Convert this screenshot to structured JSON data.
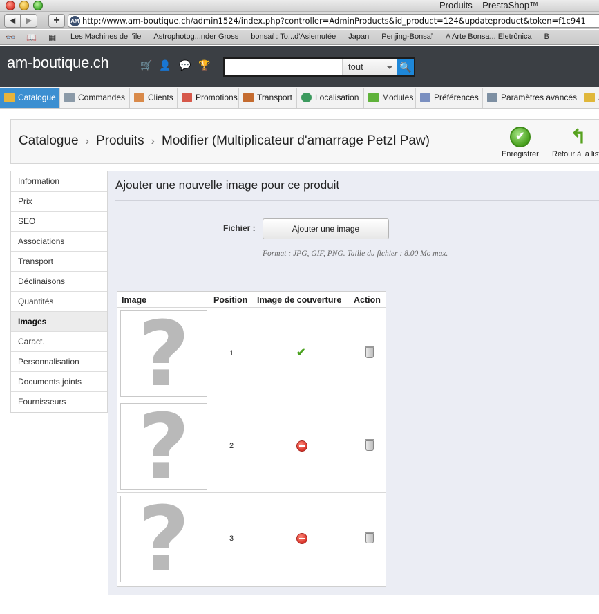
{
  "window": {
    "title": "Produits – PrestaShop™"
  },
  "browser": {
    "back": "◀",
    "forward": "▶",
    "add": "+",
    "favicon": "AM",
    "url": "http://www.am-boutique.ch/admin1524/index.php?controller=AdminProducts&id_product=124&updateproduct&token=f1c941",
    "bookmarks": [
      "Les Machines de l'île",
      "Astrophotog...nder Gross",
      "bonsaï : To...d'Asiemutée",
      "Japan",
      "Penjing-Bonsaï",
      "A Arte Bonsa... Eletrônica",
      "B"
    ]
  },
  "header": {
    "brand": "am-boutique.ch",
    "search_placeholder": "",
    "search_scope": "tout"
  },
  "tabs": [
    {
      "label": "Catalogue",
      "color": "#e9b43a"
    },
    {
      "label": "Commandes",
      "color": "#8b9aa8"
    },
    {
      "label": "Clients",
      "color": "#d98a4a"
    },
    {
      "label": "Promotions",
      "color": "#d6584a"
    },
    {
      "label": "Transport",
      "color": "#c46b2f"
    },
    {
      "label": "Localisation",
      "color": "#3c9a5e"
    },
    {
      "label": "Modules",
      "color": "#5fb23a"
    },
    {
      "label": "Préférences",
      "color": "#7a8fc0"
    },
    {
      "label": "Paramètres avancés",
      "color": "#7d8fa2"
    },
    {
      "label": "A",
      "color": "#e0b73a"
    }
  ],
  "toolbar": {
    "breadcrumb": [
      "Catalogue",
      "Produits",
      "Modifier (Multiplicateur d'amarrage Petzl Paw)"
    ],
    "save_label": "Enregistrer",
    "back_label": "Retour à la liste"
  },
  "sidebar": {
    "items": [
      "Information",
      "Prix",
      "SEO",
      "Associations",
      "Transport",
      "Déclinaisons",
      "Quantités",
      "Images",
      "Caract.",
      "Personnalisation",
      "Documents joints",
      "Fournisseurs"
    ],
    "active": "Images"
  },
  "images_panel": {
    "title": "Ajouter une nouvelle image pour ce produit",
    "file_label": "Fichier :",
    "add_button": "Ajouter une image",
    "help": "Format : JPG, GIF, PNG. Taille du fichier : 8.00 Mo max.",
    "columns": [
      "Image",
      "Position",
      "Image de couverture",
      "Action"
    ],
    "rows": [
      {
        "placeholder": "?",
        "position": "1",
        "cover": true
      },
      {
        "placeholder": "?",
        "position": "2",
        "cover": false
      },
      {
        "placeholder": "?",
        "position": "3",
        "cover": false
      }
    ]
  },
  "colors": {
    "header_bg": "#3b3f44",
    "active_tab": "#3c8fd1",
    "panel_bg": "#ebedf4"
  }
}
